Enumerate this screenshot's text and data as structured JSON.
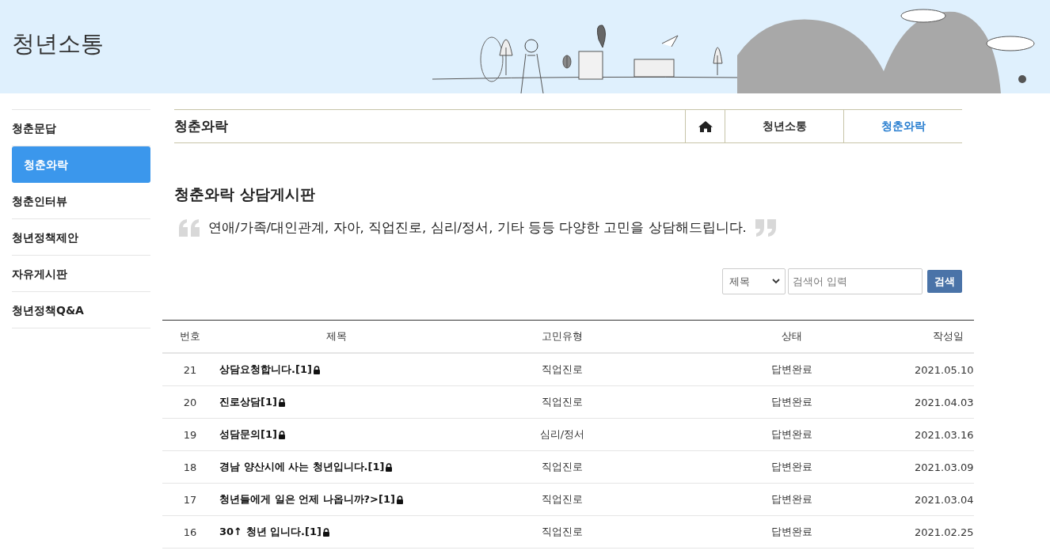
{
  "header": {
    "title": "청년소통"
  },
  "sidebar": {
    "items": [
      {
        "label": "청춘문답",
        "selected": false,
        "sub": false
      },
      {
        "label": "청춘와락",
        "selected": true,
        "sub": true
      },
      {
        "label": "청춘인터뷰",
        "selected": false,
        "sub": false
      },
      {
        "label": "청년정책제안",
        "selected": false,
        "sub": false
      },
      {
        "label": "자유게시판",
        "selected": false,
        "sub": false
      },
      {
        "label": "청년정책Q&A",
        "selected": false,
        "sub": false
      }
    ]
  },
  "location": {
    "title": "청춘와락",
    "crumbs": [
      {
        "label": "청년소통",
        "selected": false
      },
      {
        "label": "청춘와락",
        "selected": true
      }
    ]
  },
  "board": {
    "title": "청춘와락 상담게시판",
    "description": "연애/가족/대인관계, 자아, 직업진로, 심리/정서, 기타 등등 다양한 고민을 상담해드립니다."
  },
  "search": {
    "select": "제목",
    "placeholder": "검색어 입력",
    "button": "검색"
  },
  "table": {
    "columns": [
      "번호",
      "제목",
      "고민유형",
      "상태",
      "작성일"
    ],
    "rows": [
      {
        "no": "21",
        "title": "상담요청합니다.[1]",
        "locked": true,
        "type": "직업진로",
        "status": "답변완료",
        "date": "2021.05.10"
      },
      {
        "no": "20",
        "title": "진로상담[1]",
        "locked": true,
        "type": "직업진로",
        "status": "답변완료",
        "date": "2021.04.03"
      },
      {
        "no": "19",
        "title": "성담문의[1]",
        "locked": true,
        "type": "심리/정서",
        "status": "답변완료",
        "date": "2021.03.16"
      },
      {
        "no": "18",
        "title": "경남 양산시에 사는 청년입니다.[1]",
        "locked": true,
        "type": "직업진로",
        "status": "답변완료",
        "date": "2021.03.09"
      },
      {
        "no": "17",
        "title": "청년들에게 일은 언제 나옵니까?>[1]",
        "locked": true,
        "type": "직업진로",
        "status": "답변완료",
        "date": "2021.03.04"
      },
      {
        "no": "16",
        "title": "30↑ 청년 입니다.[1]",
        "locked": true,
        "type": "직업진로",
        "status": "답변완료",
        "date": "2021.02.25"
      }
    ]
  }
}
